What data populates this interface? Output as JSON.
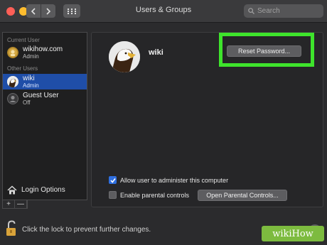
{
  "window": {
    "title": "Users & Groups",
    "search_placeholder": "Search"
  },
  "sidebar": {
    "current_user_heading": "Current User",
    "current_user": {
      "name": "wikihow.com",
      "role": "Admin"
    },
    "other_users_heading": "Other Users",
    "other_users": [
      {
        "name": "wiki",
        "role": "Admin",
        "selected": true
      },
      {
        "name": "Guest User",
        "role": "Off",
        "selected": false
      }
    ],
    "login_options_label": "Login Options",
    "add_label": "+",
    "remove_label": "—"
  },
  "main": {
    "user_name": "wiki",
    "reset_password_label": "Reset Password...",
    "allow_admin_label": "Allow user to administer this computer",
    "allow_admin_checked": true,
    "parental_controls_label": "Enable parental controls",
    "parental_controls_checked": false,
    "open_parental_label": "Open Parental Controls..."
  },
  "footer": {
    "lock_text": "Click the lock to prevent further changes.",
    "help_label": "?"
  },
  "watermark": "wikiHow",
  "colors": {
    "highlight": "#3ee42c",
    "selection": "#1f4ea8",
    "checkbox_on": "#2f6fe0"
  }
}
